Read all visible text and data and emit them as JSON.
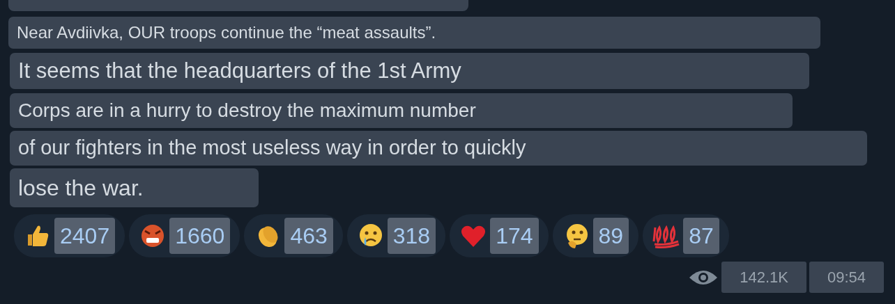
{
  "message": {
    "lines": [
      {
        "text": "Near Avdiivka, OUR troops continue the “meat assaults”."
      },
      {
        "text": "It seems that the headquarters of the 1st Army"
      },
      {
        "text": "Corps are in a hurry to destroy the maximum number"
      },
      {
        "text": "of our fighters in the most useless way in order to quickly"
      },
      {
        "text": "lose the war."
      }
    ],
    "reactions": [
      {
        "kind": "thumbs",
        "count": "2407"
      },
      {
        "kind": "angry",
        "count": "1660"
      },
      {
        "kind": "clap",
        "count": "463"
      },
      {
        "kind": "cry",
        "count": "318"
      },
      {
        "kind": "heart",
        "count": "174"
      },
      {
        "kind": "think",
        "count": "89"
      },
      {
        "kind": "hundred",
        "count": "87"
      }
    ],
    "views": "142.1K",
    "time": "09:54"
  }
}
